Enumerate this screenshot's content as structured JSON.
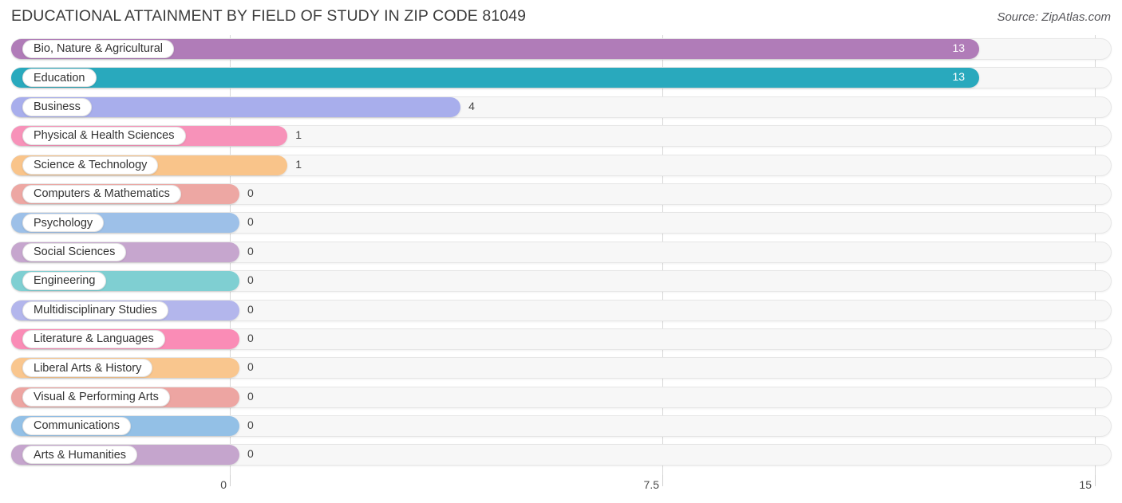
{
  "header": {
    "title": "EDUCATIONAL ATTAINMENT BY FIELD OF STUDY IN ZIP CODE 81049",
    "source": "Source: ZipAtlas.com"
  },
  "chart_data": {
    "type": "bar",
    "orientation": "horizontal",
    "title": "EDUCATIONAL ATTAINMENT BY FIELD OF STUDY IN ZIP CODE 81049",
    "xlabel": "",
    "ylabel": "",
    "xlim": [
      0,
      15
    ],
    "ticks": [
      "0",
      "7.5",
      "15"
    ],
    "tick_values": [
      0,
      7.5,
      15
    ],
    "grid": true,
    "legend": "none",
    "categories": [
      "Bio, Nature & Agricultural",
      "Education",
      "Business",
      "Physical & Health Sciences",
      "Science & Technology",
      "Computers & Mathematics",
      "Psychology",
      "Social Sciences",
      "Engineering",
      "Multidisciplinary Studies",
      "Literature & Languages",
      "Liberal Arts & History",
      "Visual & Performing Arts",
      "Communications",
      "Arts & Humanities"
    ],
    "values": [
      13,
      13,
      4,
      1,
      1,
      0,
      0,
      0,
      0,
      0,
      0,
      0,
      0,
      0,
      0
    ],
    "value_labels": [
      "13",
      "13",
      "4",
      "1",
      "1",
      "0",
      "0",
      "0",
      "0",
      "0",
      "0",
      "0",
      "0",
      "0",
      "0"
    ],
    "colors": [
      "#b07cb8",
      "#29a9bd",
      "#a8aeec",
      "#f792b9",
      "#f9c48a",
      "#eda7a3",
      "#9dc0e8",
      "#c6a6ce",
      "#7fcfd2",
      "#b3b6ec",
      "#fa8cb6",
      "#f9c68e",
      "#eda5a2",
      "#93c0e6",
      "#c5a5cd"
    ]
  }
}
